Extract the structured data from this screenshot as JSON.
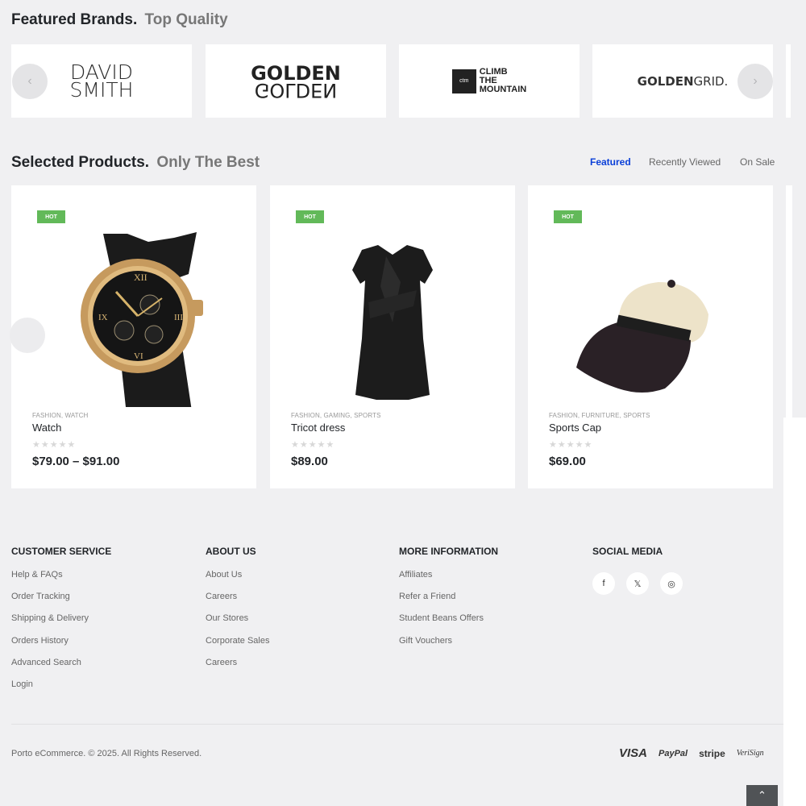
{
  "brands": {
    "title": "Featured Brands.",
    "subtitle": "Top Quality",
    "items": [
      {
        "line1": "DAVID",
        "line2": "SMITH"
      },
      {
        "top": "GOLDEN",
        "bottom": "GOLDEN"
      },
      {
        "box": "ctm",
        "lines": [
          "CLIMB",
          "THE",
          "MOUNTAIN"
        ]
      },
      {
        "bold": "GOLDEN",
        "rest": "GRID."
      }
    ],
    "prev_icon": "chevron-left-icon",
    "next_icon": "chevron-right-icon"
  },
  "products": {
    "title": "Selected Products.",
    "subtitle": "Only The Best",
    "tabs": [
      "Featured",
      "Recently Viewed",
      "On Sale"
    ],
    "active_tab": "Featured",
    "items": [
      {
        "badge": "HOT",
        "categories": "FASHION, WATCH",
        "name": "Watch",
        "rating": 0,
        "price": "$79.00 – $91.00",
        "image": "watch"
      },
      {
        "badge": "HOT",
        "categories": "FASHION, GAMING, SPORTS",
        "name": "Tricot dress",
        "rating": 0,
        "price": "$89.00",
        "image": "dress"
      },
      {
        "badge": "HOT",
        "categories": "FASHION, FURNITURE, SPORTS",
        "name": "Sports Cap",
        "rating": 0,
        "price": "$69.00",
        "image": "cap"
      }
    ]
  },
  "footer": {
    "customer_service": {
      "title": "CUSTOMER SERVICE",
      "links": [
        "Help & FAQs",
        "Order Tracking",
        "Shipping & Delivery",
        "Orders History",
        "Advanced Search",
        "Login"
      ]
    },
    "about_us": {
      "title": "ABOUT US",
      "links": [
        "About Us",
        "Careers",
        "Our Stores",
        "Corporate Sales",
        "Careers"
      ]
    },
    "more_info": {
      "title": "MORE INFORMATION",
      "links": [
        "Affiliates",
        "Refer a Friend",
        "Student Beans Offers",
        "Gift Vouchers"
      ]
    },
    "social": {
      "title": "SOCIAL MEDIA",
      "icons": [
        "facebook-icon",
        "x-icon",
        "instagram-icon"
      ]
    },
    "copyright": "Porto eCommerce. © 2025. All Rights Reserved.",
    "payments": [
      "VISA",
      "PayPal",
      "stripe",
      "VeriSign"
    ]
  },
  "colors": {
    "background": "#f0f0f2",
    "active_tab": "#0a3fd8",
    "hot_badge": "#62b959",
    "text": "#222529"
  }
}
